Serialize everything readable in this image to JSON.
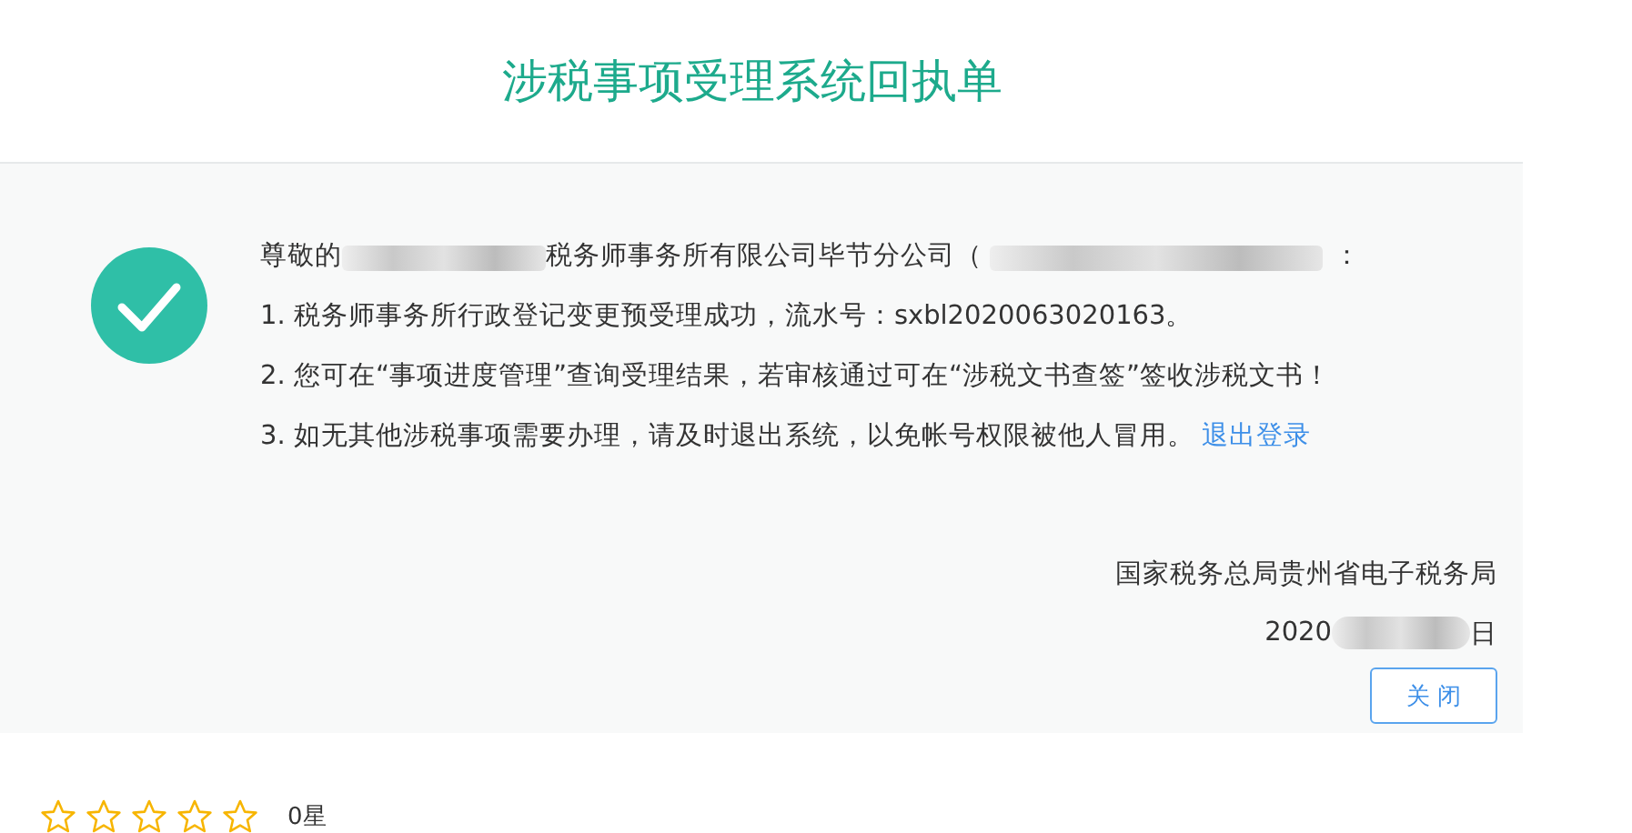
{
  "title": "涉税事项受理系统回执单",
  "greeting": {
    "prefix": "尊敬的",
    "company_visible": "税务师事务所有限公司毕节分公司（",
    "suffix": "："
  },
  "lines": [
    {
      "kind": "text",
      "text": "1. 税务师事务所行政登记变更预受理成功，流水号：sxbl2020063020163。"
    },
    {
      "kind": "text",
      "text": "2. 您可在“事项进度管理”查询受理结果，若审核通过可在“涉税文书查签”签收涉税文书！"
    },
    {
      "kind": "link",
      "text": "3. 如无其他涉税事项需要办理，请及时退出系统，以免帐号权限被他人冒用。",
      "link": "退出登录"
    }
  ],
  "issuer": "国家税务总局贵州省电子税务局",
  "date": {
    "year": "2020",
    "day": "日"
  },
  "close_button": "关 闭",
  "rating": {
    "stars": 0,
    "label": "0星"
  }
}
